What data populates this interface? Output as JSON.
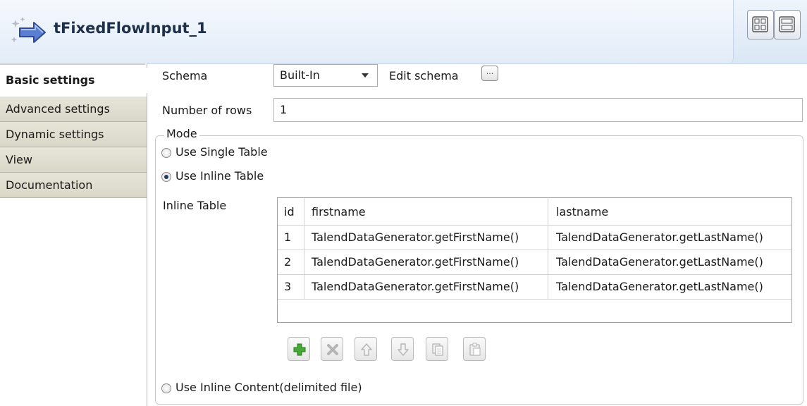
{
  "header": {
    "title": "tFixedFlowInput_1",
    "icon": "component-arrow-icon"
  },
  "tabs": [
    {
      "label": "Basic settings",
      "active": true
    },
    {
      "label": "Advanced settings",
      "active": false
    },
    {
      "label": "Dynamic settings",
      "active": false
    },
    {
      "label": "View",
      "active": false
    },
    {
      "label": "Documentation",
      "active": false
    }
  ],
  "form": {
    "schema_label": "Schema",
    "schema_value": "Built-In",
    "edit_schema_label": "Edit schema",
    "edit_schema_button": "...",
    "rows_label": "Number of rows",
    "rows_value": "1",
    "mode_label": "Mode",
    "option_single": "Use Single Table",
    "option_inline": "Use Inline Table",
    "option_content": "Use Inline Content(delimited file)",
    "selected_mode": "Use Inline Table",
    "inline_table_label": "Inline Table"
  },
  "table": {
    "headers": [
      "id",
      "firstname",
      "lastname"
    ],
    "rows": [
      [
        "1",
        "TalendDataGenerator.getFirstName()",
        "TalendDataGenerator.getLastName()"
      ],
      [
        "2",
        "TalendDataGenerator.getFirstName()",
        "TalendDataGenerator.getLastName()"
      ],
      [
        "3",
        "TalendDataGenerator.getFirstName()",
        "TalendDataGenerator.getLastName()"
      ]
    ]
  },
  "toolbar": {
    "buttons": [
      "add-icon",
      "delete-icon",
      "move-up-icon",
      "move-down-icon",
      "copy-icon",
      "paste-icon"
    ]
  },
  "colors": {
    "header_bg": "#e3edf8",
    "tab_bg": "#d9d7c8",
    "add_green": "#3b9a2d",
    "title_color": "#1e2f4a"
  }
}
